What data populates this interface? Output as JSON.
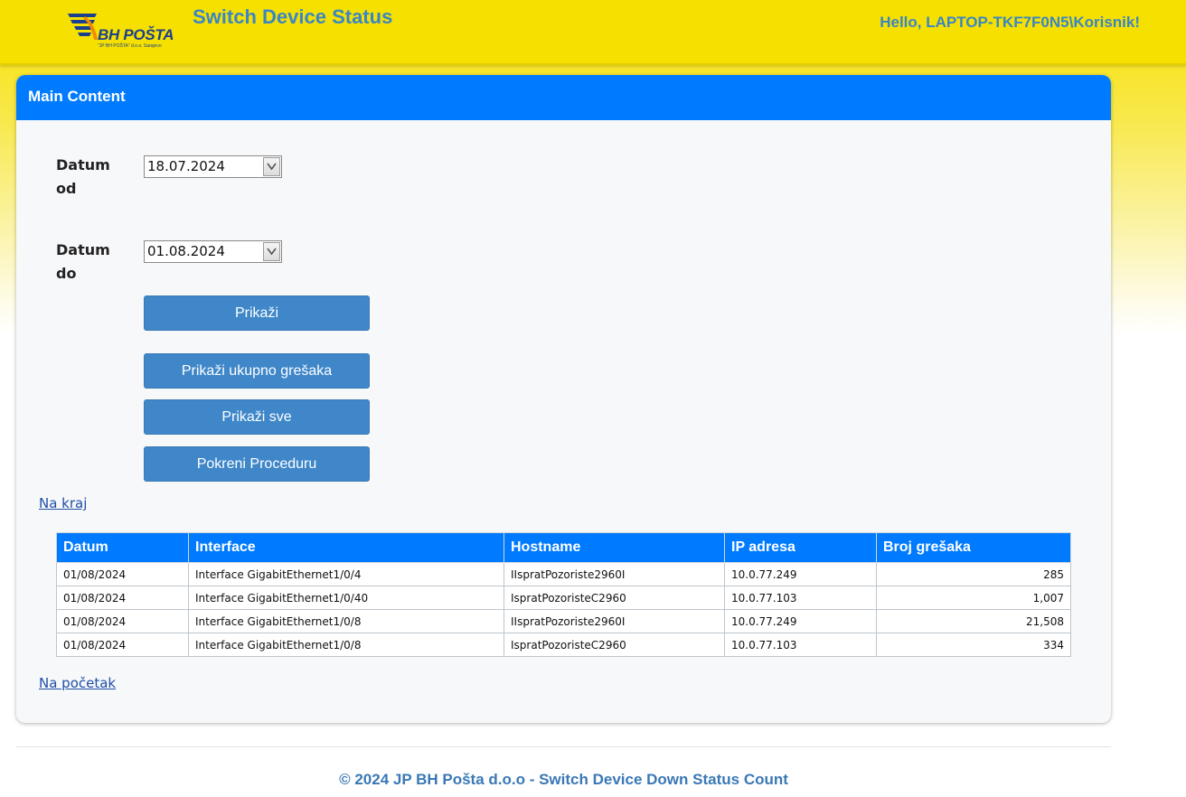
{
  "header": {
    "logo_text": "BH POŠTA",
    "logo_subtext": "\"JP BH POŠTA\" d.o.o. Sarajevo",
    "title": "Switch Device Status",
    "greeting": "Hello, LAPTOP-TKF7F0N5\\Korisnik!"
  },
  "main": {
    "header": "Main Content",
    "date_from": {
      "label_line1": "Datum",
      "label_line2": "od",
      "value": "18.07.2024"
    },
    "date_to": {
      "label_line1": "Datum",
      "label_line2": "do",
      "value": "01.08.2024"
    },
    "buttons": {
      "show": "Prikaži",
      "show_total": "Prikaži ukupno grešaka",
      "show_all": "Prikaži sve",
      "run_procedure": "Pokreni Proceduru"
    },
    "link_end": "Na kraj",
    "link_start": "Na početak",
    "table": {
      "columns": [
        "Datum",
        "Interface",
        "Hostname",
        "IP adresa",
        "Broj grešaka"
      ],
      "rows": [
        [
          "01/08/2024",
          "Interface GigabitEthernet1/0/4",
          "IIspratPozoriste2960I",
          "10.0.77.249",
          "285"
        ],
        [
          "01/08/2024",
          "Interface GigabitEthernet1/0/40",
          "IspratPozoristeC2960",
          "10.0.77.103",
          "1,007"
        ],
        [
          "01/08/2024",
          "Interface GigabitEthernet1/0/8",
          "IIspratPozoriste2960I",
          "10.0.77.249",
          "21,508"
        ],
        [
          "01/08/2024",
          "Interface GigabitEthernet1/0/8",
          "IspratPozoristeC2960",
          "10.0.77.103",
          "334"
        ]
      ]
    }
  },
  "footer": {
    "text": "© 2024 JP BH Pošta d.o.o - Switch Device Down Status Count"
  },
  "colors": {
    "brand_yellow": "#f6e000",
    "accent_blue": "#007bff",
    "button_blue": "#3f87c9",
    "title_blue": "#3a86c4"
  },
  "icons": {
    "logo": "bh-posta-logo-icon",
    "dropdown": "chevron-down-icon"
  }
}
